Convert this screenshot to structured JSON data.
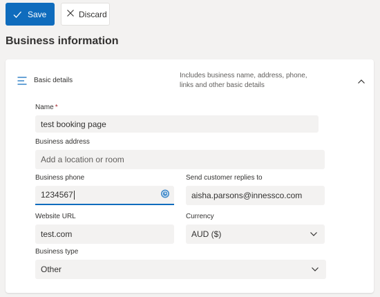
{
  "toolbar": {
    "save_label": "Save",
    "discard_label": "Discard"
  },
  "page": {
    "title": "Business information"
  },
  "section": {
    "title": "Basic details",
    "description": "Includes business name, address, phone, links and other basic details",
    "expanded": true
  },
  "form": {
    "name": {
      "label": "Name",
      "required": "*",
      "value": "test booking page"
    },
    "address": {
      "label": "Business address",
      "placeholder": "Add a location or room"
    },
    "phone": {
      "label": "Business phone",
      "value": "1234567"
    },
    "reply_email": {
      "label": "Send customer replies to",
      "value": "aisha.parsons@innessco.com"
    },
    "website": {
      "label": "Website URL",
      "value": "test.com"
    },
    "currency": {
      "label": "Currency",
      "value": "AUD ($)"
    },
    "business_type": {
      "label": "Business type",
      "value": "Other"
    }
  },
  "colors": {
    "accent": "#0f6cbd",
    "page_background": "#f3f2f1",
    "field_background": "#f3f2f1",
    "required": "#a4262c"
  },
  "icons": {
    "save": "checkmark-icon",
    "discard": "close-icon",
    "section": "list-lines-icon",
    "collapse": "chevron-up-icon",
    "phone_status": "clock-icon",
    "dropdown": "chevron-down-icon"
  }
}
